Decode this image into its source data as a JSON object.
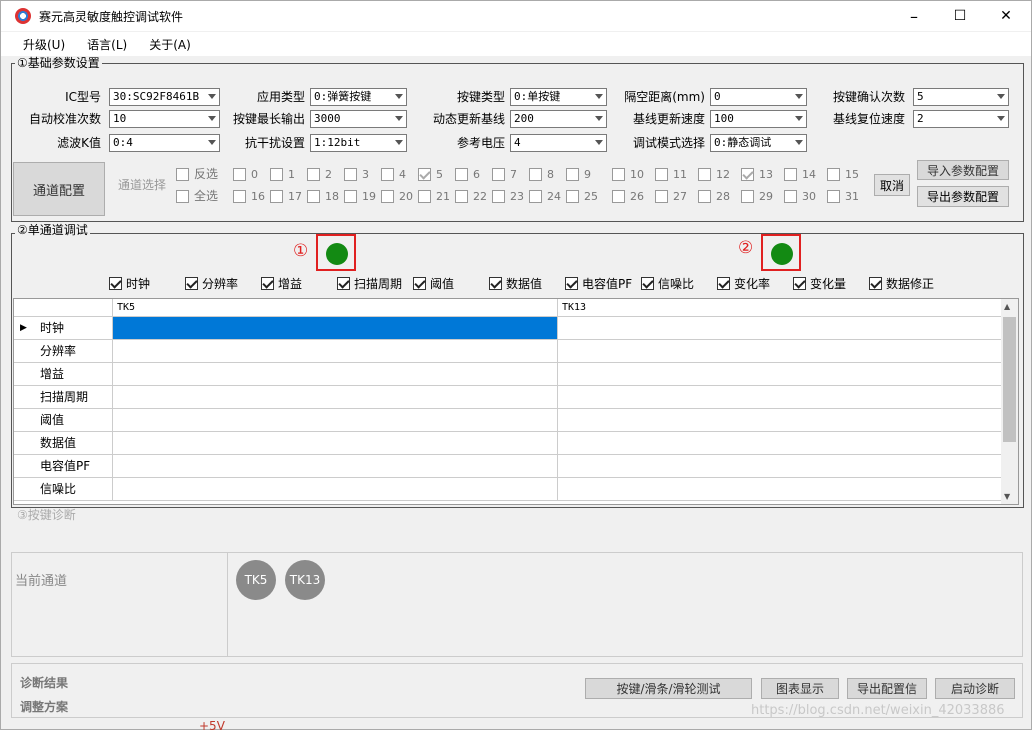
{
  "window": {
    "title": "赛元高灵敏度触控调试软件",
    "min": "–",
    "max": "☐",
    "close": "✕"
  },
  "menu": [
    "升级(U)",
    "语言(L)",
    "关于(A)"
  ],
  "basic": {
    "title": "①基础参数设置",
    "rows": [
      [
        {
          "label": "IC型号",
          "value": "30:SC92F8461B"
        },
        {
          "label": "应用类型",
          "value": "0:弹簧按键"
        },
        {
          "label": "按键类型",
          "value": "0:单按键"
        },
        {
          "label": "隔空距离(mm)",
          "value": "0"
        },
        {
          "label": "按键确认次数",
          "value": "5"
        }
      ],
      [
        {
          "label": "自动校准次数",
          "value": "10"
        },
        {
          "label": "按键最长输出",
          "value": "3000"
        },
        {
          "label": "动态更新基线",
          "value": "200"
        },
        {
          "label": "基线更新速度",
          "value": "100"
        },
        {
          "label": "基线复位速度",
          "value": "2"
        }
      ],
      [
        {
          "label": "滤波K值",
          "value": "0:4"
        },
        {
          "label": "抗干扰设置",
          "value": "1:12bit"
        },
        {
          "label": "参考电压",
          "value": "4"
        },
        {
          "label": "调试模式选择",
          "value": "0:静态调试"
        }
      ]
    ],
    "channel_config": "通道配置",
    "channel_select": "通道选择",
    "invert": "反选",
    "all": "全选",
    "channels_row1": [
      "0",
      "1",
      "2",
      "3",
      "4",
      "5",
      "6",
      "7",
      "8",
      "9",
      "10",
      "11",
      "12",
      "13",
      "14",
      "15"
    ],
    "channels_row2": [
      "16",
      "17",
      "18",
      "19",
      "20",
      "21",
      "22",
      "23",
      "24",
      "25",
      "26",
      "27",
      "28",
      "29",
      "30",
      "31"
    ],
    "checked": [
      "5",
      "13"
    ],
    "cancel": "取消",
    "import": "导入参数配置",
    "export": "导出参数配置"
  },
  "single": {
    "title": "②单通道调试",
    "marker1": "①",
    "marker2": "②",
    "views": [
      "时钟",
      "分辨率",
      "增益",
      "扫描周期",
      "阈值",
      "数据值",
      "电容值PF",
      "信噪比",
      "变化率",
      "变化量",
      "数据修正"
    ],
    "columns": [
      "TK5",
      "TK13"
    ],
    "rows": [
      "时钟",
      "分辨率",
      "增益",
      "扫描周期",
      "阈值",
      "数据值",
      "电容值PF",
      "信噪比"
    ],
    "row_marker": "▶"
  },
  "diag": {
    "title": "③按键诊断",
    "current": "当前通道",
    "chips": [
      "TK5",
      "TK13"
    ],
    "result": "诊断结果",
    "plan": "调整方案",
    "buttons": [
      "按键/滑条/滑轮测试",
      "图表显示",
      "导出配置信",
      "启动诊断"
    ]
  },
  "watermark": "https://blog.csdn.net/weixin_42033886",
  "bg_text": "+5V"
}
